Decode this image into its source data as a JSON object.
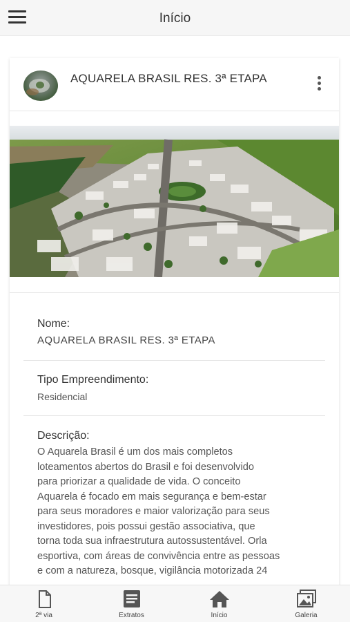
{
  "header": {
    "title": "Início",
    "menu_icon": "hamburger-menu-icon"
  },
  "card": {
    "title": "AQUARELA BRASIL RES. 3ª ETAPA",
    "more_icon": "more-vertical-icon"
  },
  "details": {
    "name_label": "Nome:",
    "name_value": "AQUARELA BRASIL RES. 3ª ETAPA",
    "type_label": "Tipo Empreendimento:",
    "type_value": "Residencial",
    "description_label": "Descrição:",
    "description_lines": [
      "O Aquarela Brasil é um dos mais completos",
      "loteamentos abertos do Brasil e foi desenvolvido",
      "para priorizar a qualidade de vida. O conceito",
      "Aquarela é focado em mais segurança e bem-estar",
      "para seus moradores e maior valorização para seus",
      "investidores, pois possui gestão associativa, que",
      "torna toda sua infraestrutura autossustentável. Orla",
      "esportiva, com áreas de convivência entre as pessoas",
      "e com a natureza, bosque, vigilância motorizada 24"
    ]
  },
  "bottom_nav": {
    "items": [
      {
        "label": "2ª via",
        "icon": "document-icon"
      },
      {
        "label": "Extratos",
        "icon": "list-icon"
      },
      {
        "label": "Início",
        "icon": "home-icon"
      },
      {
        "label": "Galeria",
        "icon": "gallery-icon"
      }
    ]
  },
  "colors": {
    "header_bg": "#f6f6f6",
    "text": "#333333",
    "nav_icon": "#555555"
  }
}
